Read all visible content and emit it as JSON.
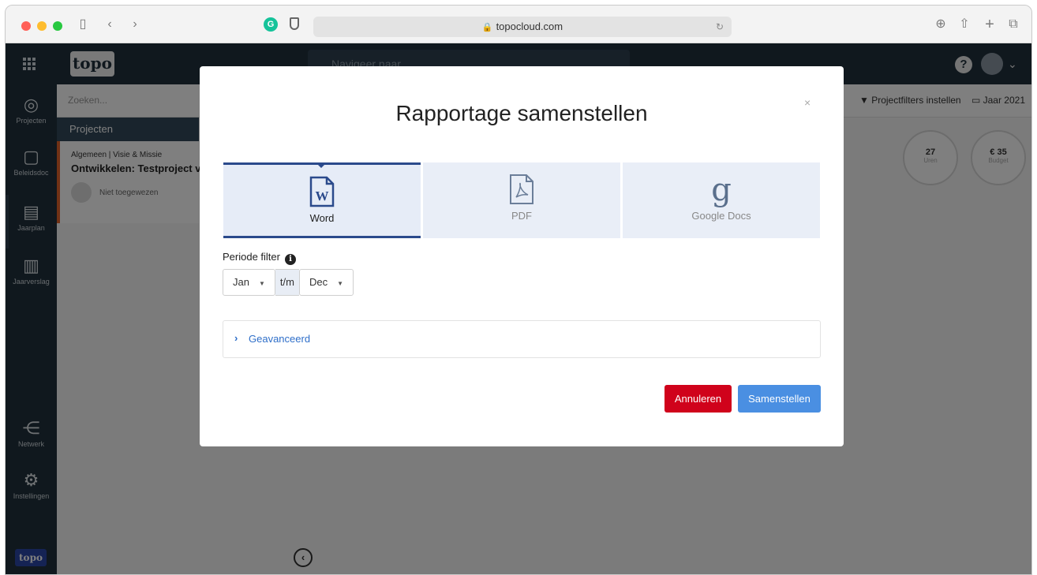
{
  "browser": {
    "url": "topocloud.com"
  },
  "app": {
    "logo": "topo",
    "nav_search_placeholder": "Navigeer naar...",
    "sidebar": [
      {
        "label": "Projecten"
      },
      {
        "label": "Beleidsdoc"
      },
      {
        "label": "Jaarplan"
      },
      {
        "label": "Jaarverslag"
      },
      {
        "label": "Netwerk"
      },
      {
        "label": "Instellingen"
      }
    ],
    "search_placeholder": "Zoeken...",
    "filters_label": "▼ Projectfilters instellen",
    "year_label": "Jaar 2021",
    "projects_header": "Projecten",
    "project": {
      "category": "Algemeen | Visie & Missie",
      "title": "Ontwikkelen: Testproject v",
      "assignee": "Niet toegewezen"
    },
    "stats": [
      {
        "value": "27",
        "label": "Uren"
      },
      {
        "value": "€ 35",
        "label": "Budget"
      }
    ]
  },
  "modal": {
    "title": "Rapportage samenstellen",
    "close": "×",
    "formats": [
      {
        "label": "Word",
        "icon": "word-document-icon",
        "active": true
      },
      {
        "label": "PDF",
        "icon": "pdf-document-icon",
        "active": false
      },
      {
        "label": "Google Docs",
        "icon": "google-icon",
        "active": false
      }
    ],
    "period_label": "Periode filter",
    "period_from": "Jan",
    "period_sep": "t/m",
    "period_to": "Dec",
    "advanced_label": "Geavanceerd",
    "cancel_label": "Annuleren",
    "submit_label": "Samenstellen"
  },
  "colors": {
    "cancel": "#d0021b",
    "submit": "#4a8fe2",
    "active_tile": "#2b4a8c",
    "nav": "#20303c"
  }
}
